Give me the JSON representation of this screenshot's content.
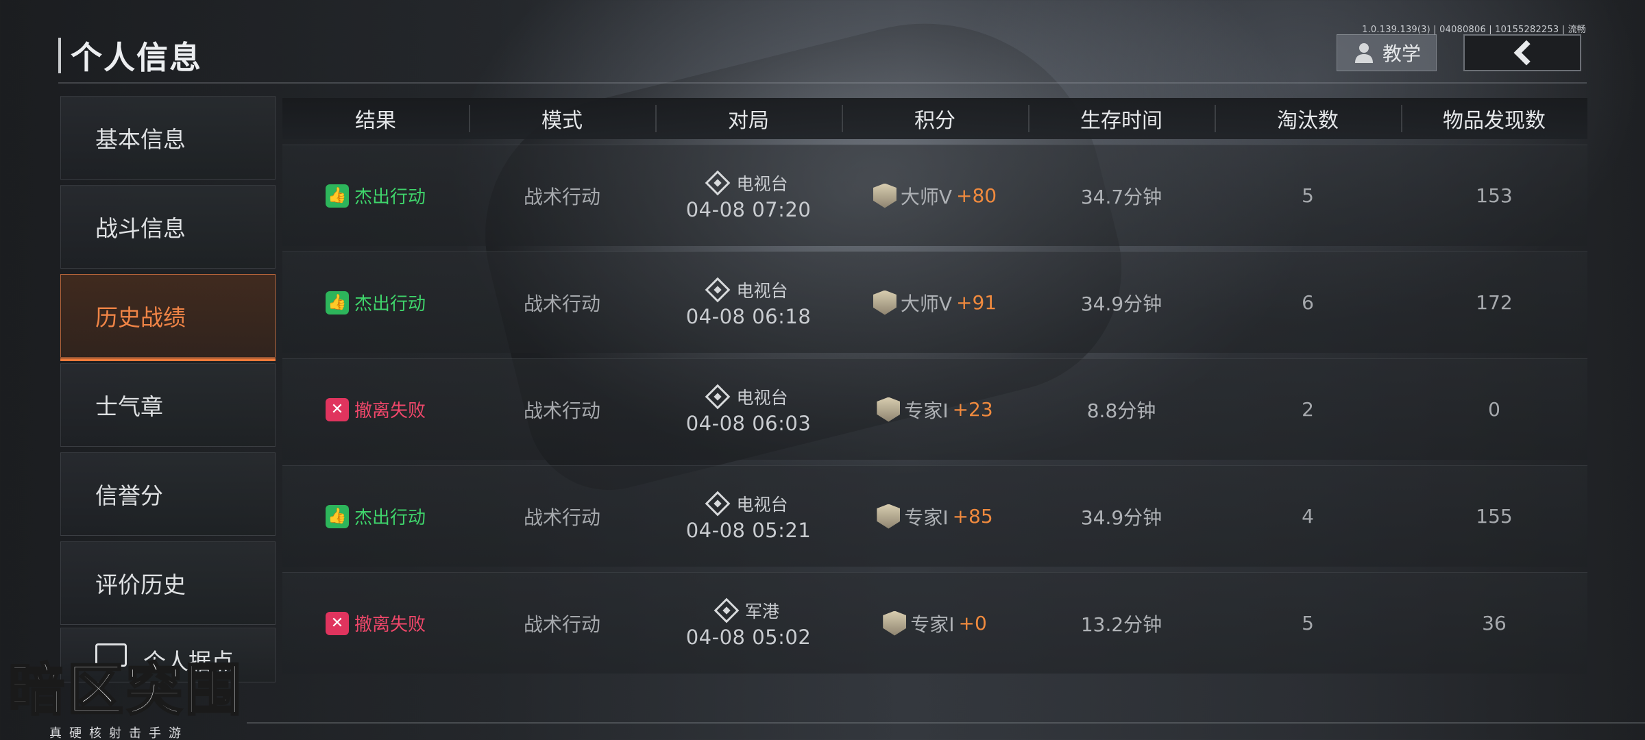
{
  "header": {
    "title": "个人信息",
    "build_info": "1.0.139.139(3) | 04080806 | 10155282253 | 流畅",
    "tutorial_label": "教学"
  },
  "sidebar": {
    "items": [
      {
        "label": "基本信息"
      },
      {
        "label": "战斗信息"
      },
      {
        "label": "历史战绩",
        "active": true
      },
      {
        "label": "士气章"
      },
      {
        "label": "信誉分"
      },
      {
        "label": "评价历史"
      },
      {
        "label": "个人据点"
      }
    ]
  },
  "table": {
    "columns": [
      "结果",
      "模式",
      "对局",
      "积分",
      "生存时间",
      "淘汰数",
      "物品发现数"
    ],
    "rows": [
      {
        "result": "杰出行动",
        "result_type": "win",
        "mode": "战术行动",
        "map": "电视台",
        "time": "04-08 07:20",
        "rank": "大师V",
        "delta": "+80",
        "survival": "34.7分钟",
        "kills": "5",
        "items": "153"
      },
      {
        "result": "杰出行动",
        "result_type": "win",
        "mode": "战术行动",
        "map": "电视台",
        "time": "04-08 06:18",
        "rank": "大师V",
        "delta": "+91",
        "survival": "34.9分钟",
        "kills": "6",
        "items": "172"
      },
      {
        "result": "撤离失败",
        "result_type": "lose",
        "mode": "战术行动",
        "map": "电视台",
        "time": "04-08 06:03",
        "rank": "专家I",
        "delta": "+23",
        "survival": "8.8分钟",
        "kills": "2",
        "items": "0"
      },
      {
        "result": "杰出行动",
        "result_type": "win",
        "mode": "战术行动",
        "map": "电视台",
        "time": "04-08 05:21",
        "rank": "专家I",
        "delta": "+85",
        "survival": "34.9分钟",
        "kills": "4",
        "items": "155"
      },
      {
        "result": "撤离失败",
        "result_type": "lose",
        "mode": "战术行动",
        "map": "军港",
        "time": "04-08 05:02",
        "rank": "专家I",
        "delta": "+0",
        "survival": "13.2分钟",
        "kills": "5",
        "items": "36"
      }
    ]
  },
  "logo": {
    "title": "暗区突围",
    "subtitle": "真硬核射击手游"
  },
  "colors": {
    "accent": "#ef8446",
    "win": "#3fd46b",
    "lose": "#f0476a",
    "score_delta": "#f08a3e"
  },
  "icons": {
    "tutorial": "user-icon",
    "back": "chevron-left-icon",
    "win": "thumbs-up-icon",
    "lose": "fail-icon",
    "map": "diamond-location-icon",
    "rank": "rank-chevron-icon",
    "base": "base-icon"
  }
}
